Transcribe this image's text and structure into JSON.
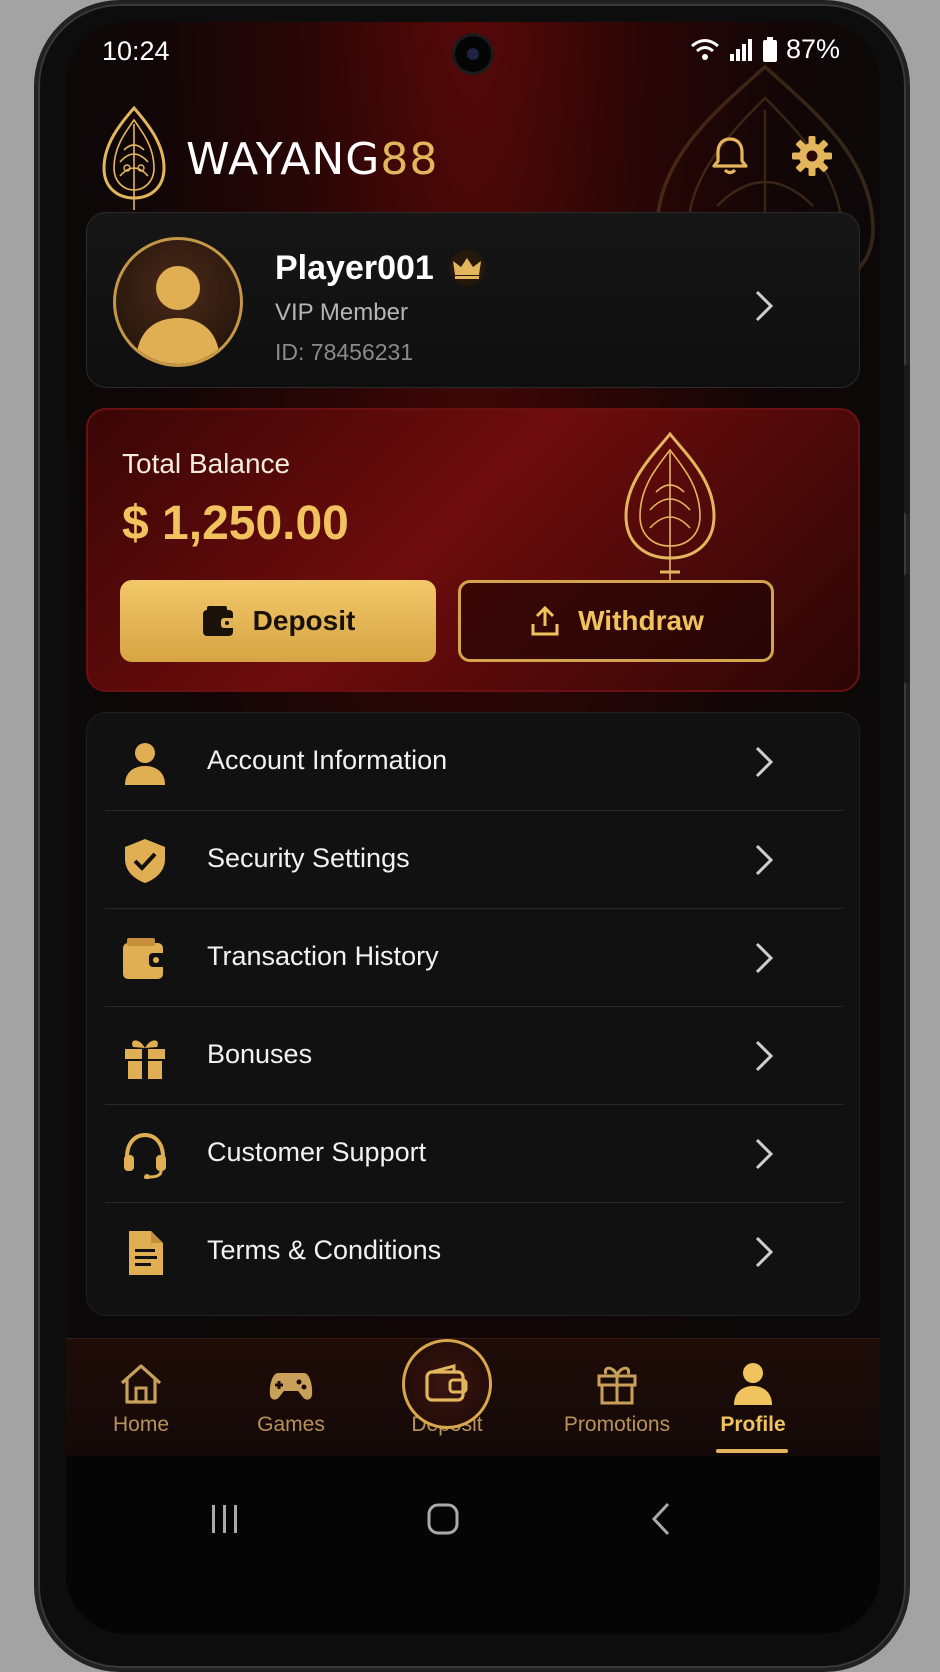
{
  "status_bar": {
    "time": "10:24",
    "battery": "87%"
  },
  "brand": {
    "name_text": "WAYANG",
    "name_number": "88"
  },
  "header": {
    "notifications_icon": "bell-icon",
    "settings_icon": "gear-icon"
  },
  "profile": {
    "name": "Player001",
    "badge_icon": "crown-icon",
    "membership": "VIP Member",
    "id_text": "ID: 78456231"
  },
  "balance": {
    "label": "Total Balance",
    "amount": "$ 1,250.00",
    "deposit_label": "Deposit",
    "withdraw_label": "Withdraw"
  },
  "menu": {
    "items": [
      {
        "label": "Account Information",
        "icon": "user-icon"
      },
      {
        "label": "Security Settings",
        "icon": "shield-check-icon"
      },
      {
        "label": "Transaction History",
        "icon": "wallet-icon"
      },
      {
        "label": "Bonuses",
        "icon": "gift-icon"
      },
      {
        "label": "Customer Support",
        "icon": "headset-icon"
      },
      {
        "label": "Terms & Conditions",
        "icon": "document-icon"
      }
    ]
  },
  "nav": {
    "items": [
      {
        "label": "Home",
        "icon": "home-icon"
      },
      {
        "label": "Games",
        "icon": "gamepad-icon"
      },
      {
        "label": "Deposit",
        "icon": "wallet-icon"
      },
      {
        "label": "Promotions",
        "icon": "gift-icon"
      },
      {
        "label": "Profile",
        "icon": "user-icon",
        "active": true
      }
    ]
  },
  "colors": {
    "gold": "#e3b65d",
    "deep_red": "#6e0c0c",
    "background": "#0b0909"
  }
}
